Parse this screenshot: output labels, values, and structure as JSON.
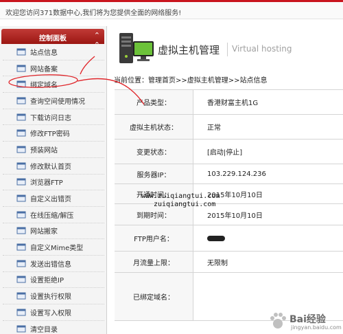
{
  "topbar": {
    "welcome": "欢迎您访问371数据中心,我们将为您提供全面的网络服务!"
  },
  "sidebar": {
    "title": "控制面板",
    "collapse_icon": "double-chevron-up-icon",
    "items": [
      {
        "label": "站点信息"
      },
      {
        "label": "网站备案"
      },
      {
        "label": "绑定域名"
      },
      {
        "label": "查询空间使用情况"
      },
      {
        "label": "下载访问日志"
      },
      {
        "label": "修改FTP密码"
      },
      {
        "label": "预装网站"
      },
      {
        "label": "修改默认首页"
      },
      {
        "label": "浏览器FTP"
      },
      {
        "label": "自定义出错页"
      },
      {
        "label": "在线压缩/解压"
      },
      {
        "label": "网站搬家"
      },
      {
        "label": "自定义Mime类型"
      },
      {
        "label": "发送出错信息"
      },
      {
        "label": "设置拒绝IP"
      },
      {
        "label": "设置执行权限"
      },
      {
        "label": "设置写入权限"
      },
      {
        "label": "清空目录"
      }
    ]
  },
  "header": {
    "title": "虚拟主机管理",
    "subtitle": "Virtual hosting"
  },
  "breadcrumb": "当前位置：管理首页>>虚拟主机管理>>站点信息",
  "info": {
    "rows": [
      {
        "label": "产品类型：",
        "value": "香港财富主机1G"
      },
      {
        "label": "虚拟主机状态：",
        "value": "正常"
      },
      {
        "label": "变更状态：",
        "value": "[启动|停止]"
      },
      {
        "label": "服务器IP：",
        "value": "103.229.124.236"
      },
      {
        "label": "开通时间：",
        "value": "2015年10月10日"
      },
      {
        "label": "到期时间：",
        "value": "2015年10月10日"
      },
      {
        "label": "FTP用户名：",
        "value": ""
      },
      {
        "label": "月流量上限：",
        "value": "无限制"
      },
      {
        "label": "已绑定域名：",
        "value": ""
      }
    ],
    "bound_domains": [
      "www.zuiqiangtui.com",
      "zuiqiangtui.com"
    ]
  },
  "watermark": {
    "text": "Bai经验",
    "sub": "jingyan.baidu.com"
  },
  "colors": {
    "accent_red": "#c9151e",
    "panel_header": "#9b1713",
    "annotation_red": "#e0262b"
  }
}
